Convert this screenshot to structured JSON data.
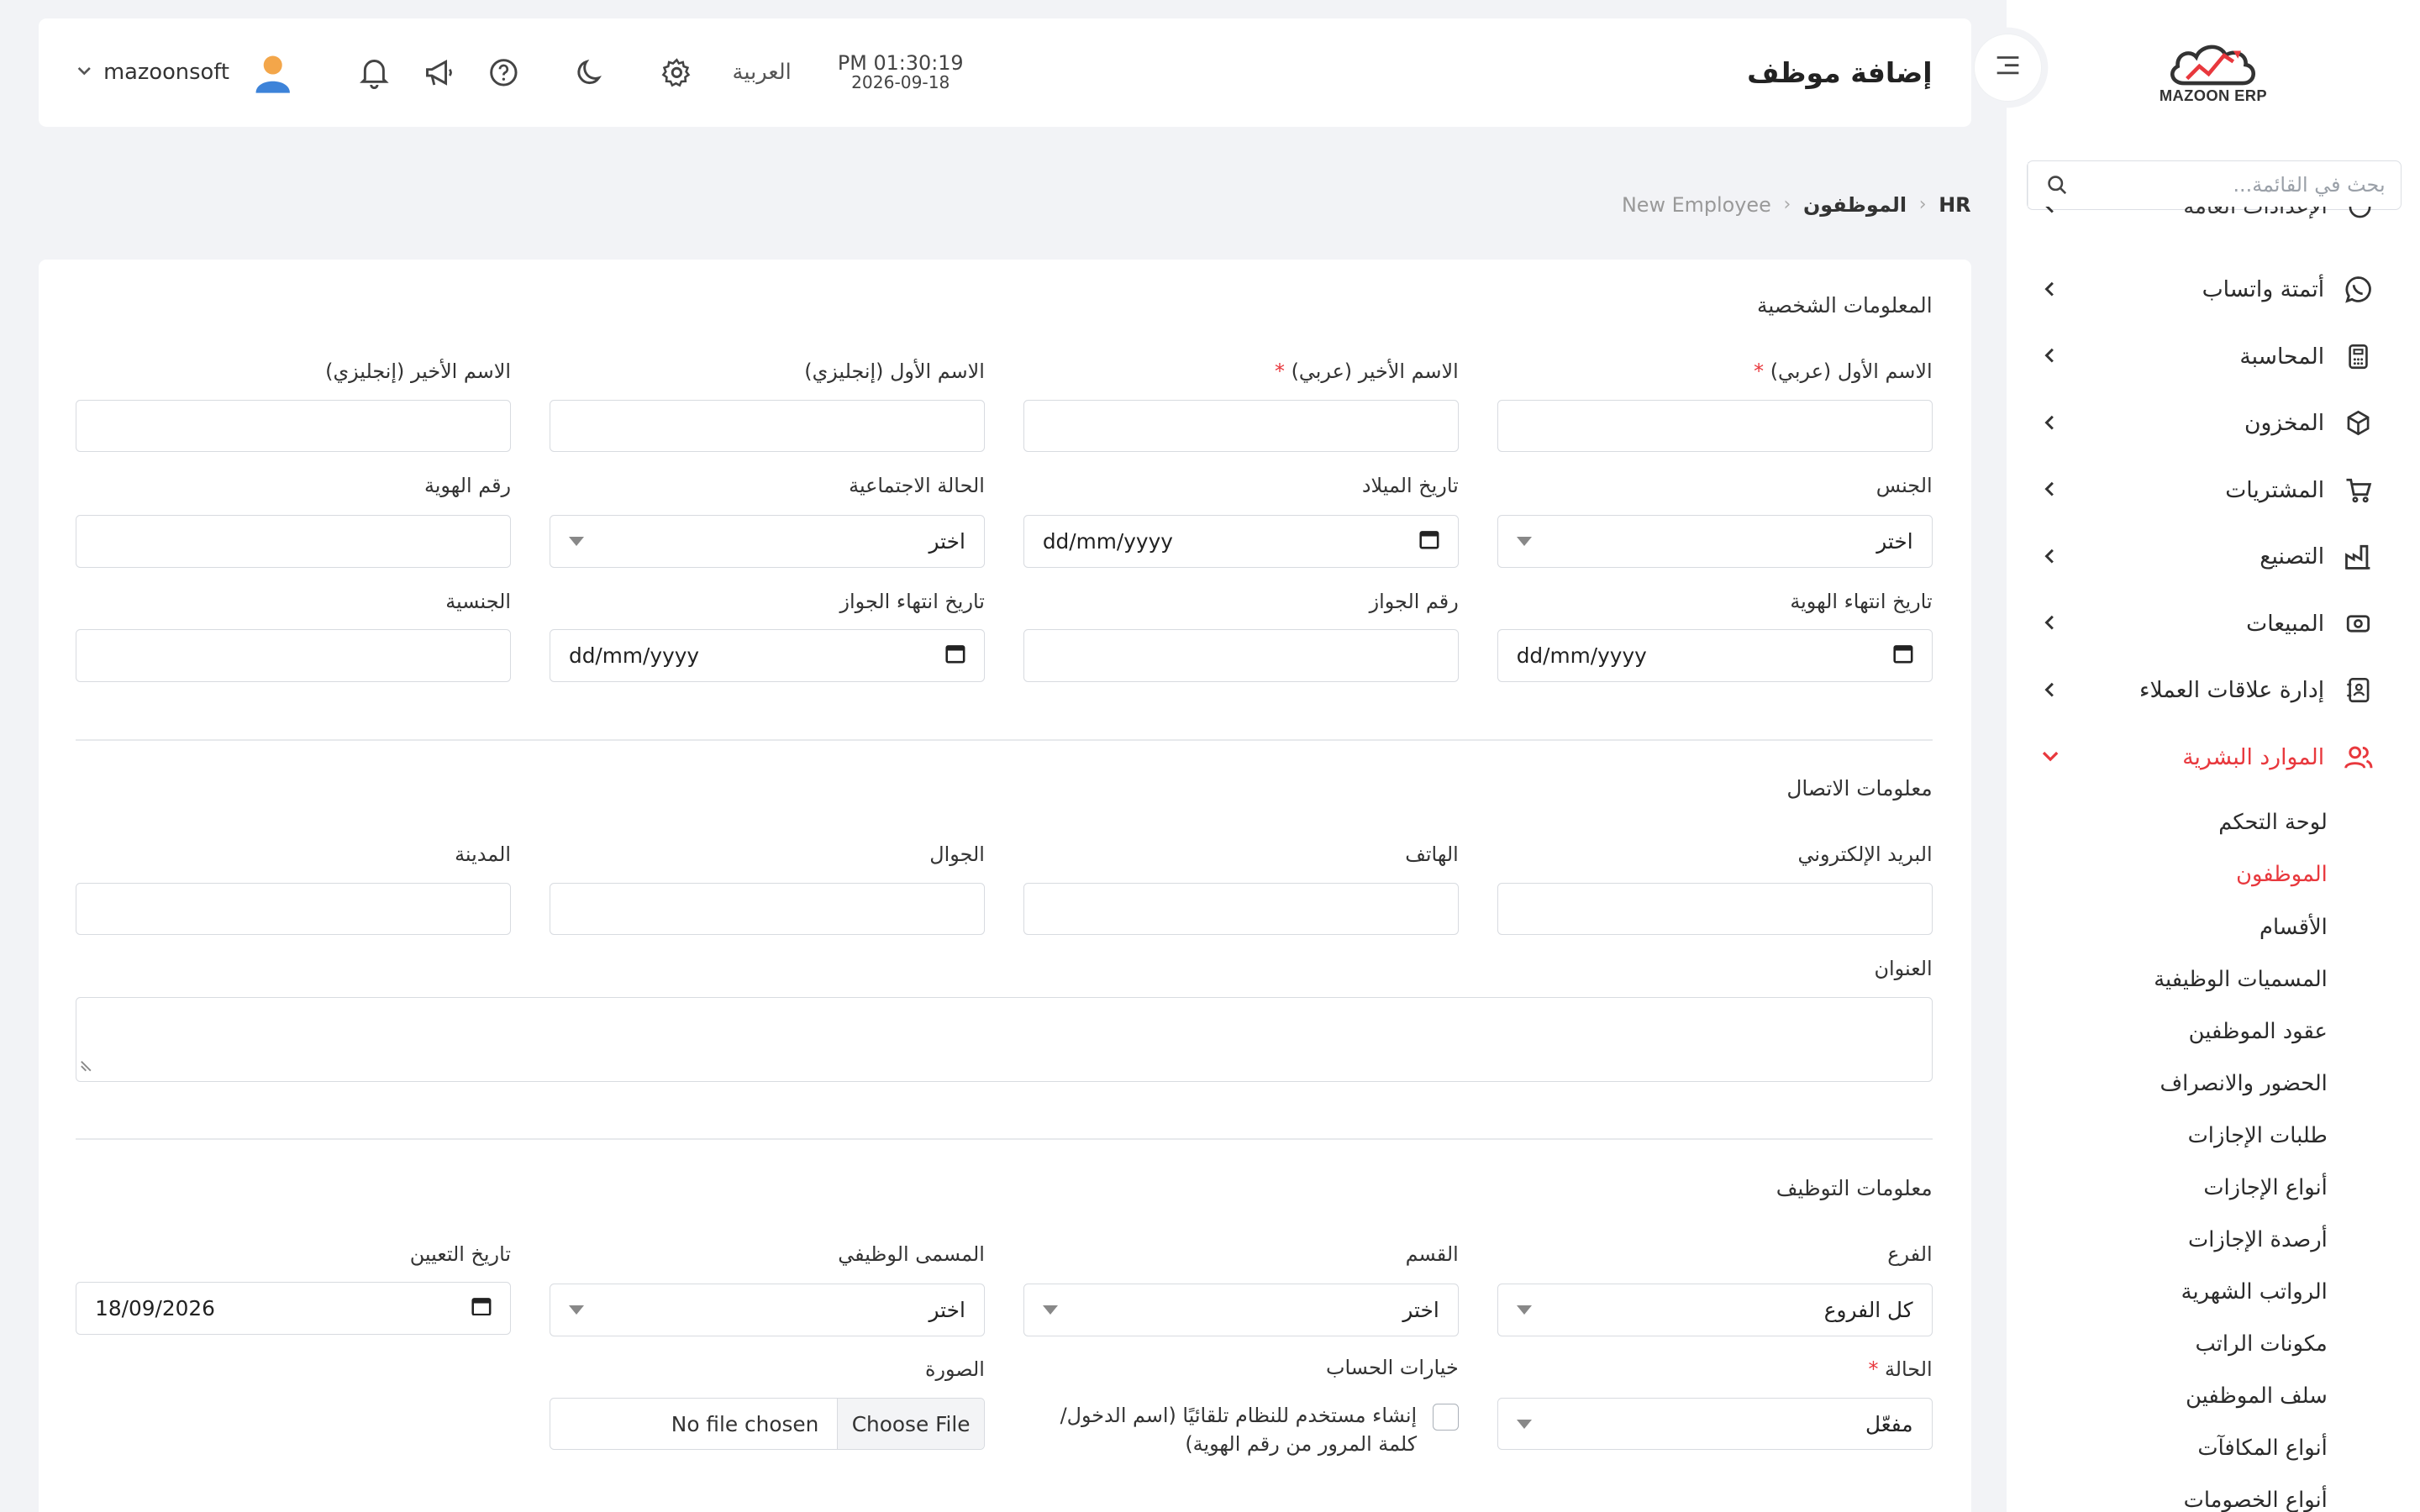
{
  "app": {
    "logo_text": "MAZOON ERP"
  },
  "sidebar": {
    "search_placeholder": "بحث في القائمة...",
    "partial_item": "الإعدادات العامة",
    "items": [
      {
        "label": "أتمتة واتساب",
        "icon": "whatsapp-icon"
      },
      {
        "label": "المحاسبة",
        "icon": "calculator-icon"
      },
      {
        "label": "المخزون",
        "icon": "box-icon"
      },
      {
        "label": "المشتريات",
        "icon": "cart-icon"
      },
      {
        "label": "التصنيع",
        "icon": "factory-icon"
      },
      {
        "label": "المبيعات",
        "icon": "cash-icon"
      },
      {
        "label": "إدارة علاقات العملاء",
        "icon": "contacts-icon"
      },
      {
        "label": "الموارد البشرية",
        "icon": "users-icon",
        "active": true
      }
    ],
    "hr_sub": [
      "لوحة التحكم",
      "الموظفون",
      "الأقسام",
      "المسميات الوظيفية",
      "عقود الموظفين",
      "الحضور والانصراف",
      "طلبات الإجازات",
      "أنواع الإجازات",
      "أرصدة الإجازات",
      "الرواتب الشهرية",
      "مكونات الراتب",
      "سلف الموظفين",
      "أنواع المكافآت",
      "أنواع الخصومات"
    ],
    "active_sub": "الموظفون"
  },
  "header": {
    "title": "إضافة موظف",
    "time": "PM 01:30:19",
    "date": "2026-09-18",
    "language": "العربية",
    "username": "mazoonsoft"
  },
  "breadcrumb": {
    "root": "HR",
    "section": "الموظفون",
    "current": "New Employee"
  },
  "form": {
    "personal": {
      "title": "المعلومات الشخصية",
      "first_name_ar": "الاسم الأول (عربي)",
      "last_name_ar": "الاسم الأخير (عربي)",
      "first_name_en": "الاسم الأول (إنجليزي)",
      "last_name_en": "الاسم الأخير (إنجليزي)",
      "gender": "الجنس",
      "birth_date": "تاريخ الميلاد",
      "marital_status": "الحالة الاجتماعية",
      "id_number": "رقم الهوية",
      "id_expiry": "تاريخ انتهاء الهوية",
      "passport_number": "رقم الجواز",
      "passport_expiry": "تاريخ انتهاء الجواز",
      "nationality": "الجنسية"
    },
    "contact": {
      "title": "معلومات الاتصال",
      "email": "البريد الإلكتروني",
      "phone": "الهاتف",
      "mobile": "الجوال",
      "city": "المدينة",
      "address": "العنوان"
    },
    "employment": {
      "title": "معلومات التوظيف",
      "branch": "الفرع",
      "branch_value": "كل الفروع",
      "department": "القسم",
      "job_title": "المسمى الوظيفي",
      "hire_date": "تاريخ التعيين",
      "hire_date_value": "18/09/2026",
      "status": "الحالة",
      "status_value": "مفعّل",
      "account_options": "خيارات الحساب",
      "account_checkbox": "إنشاء مستخدم للنظام تلقائيًا (اسم الدخول/كلمة المرور من رقم الهوية)",
      "photo": "الصورة",
      "choose_file": "Choose File",
      "no_file": "No file chosen"
    },
    "select_placeholder": "اختر",
    "date_placeholder": "dd/mm/yyyy",
    "required_mark": "*"
  },
  "colors": {
    "accent": "#e8383d",
    "background": "#f2f3f6"
  }
}
